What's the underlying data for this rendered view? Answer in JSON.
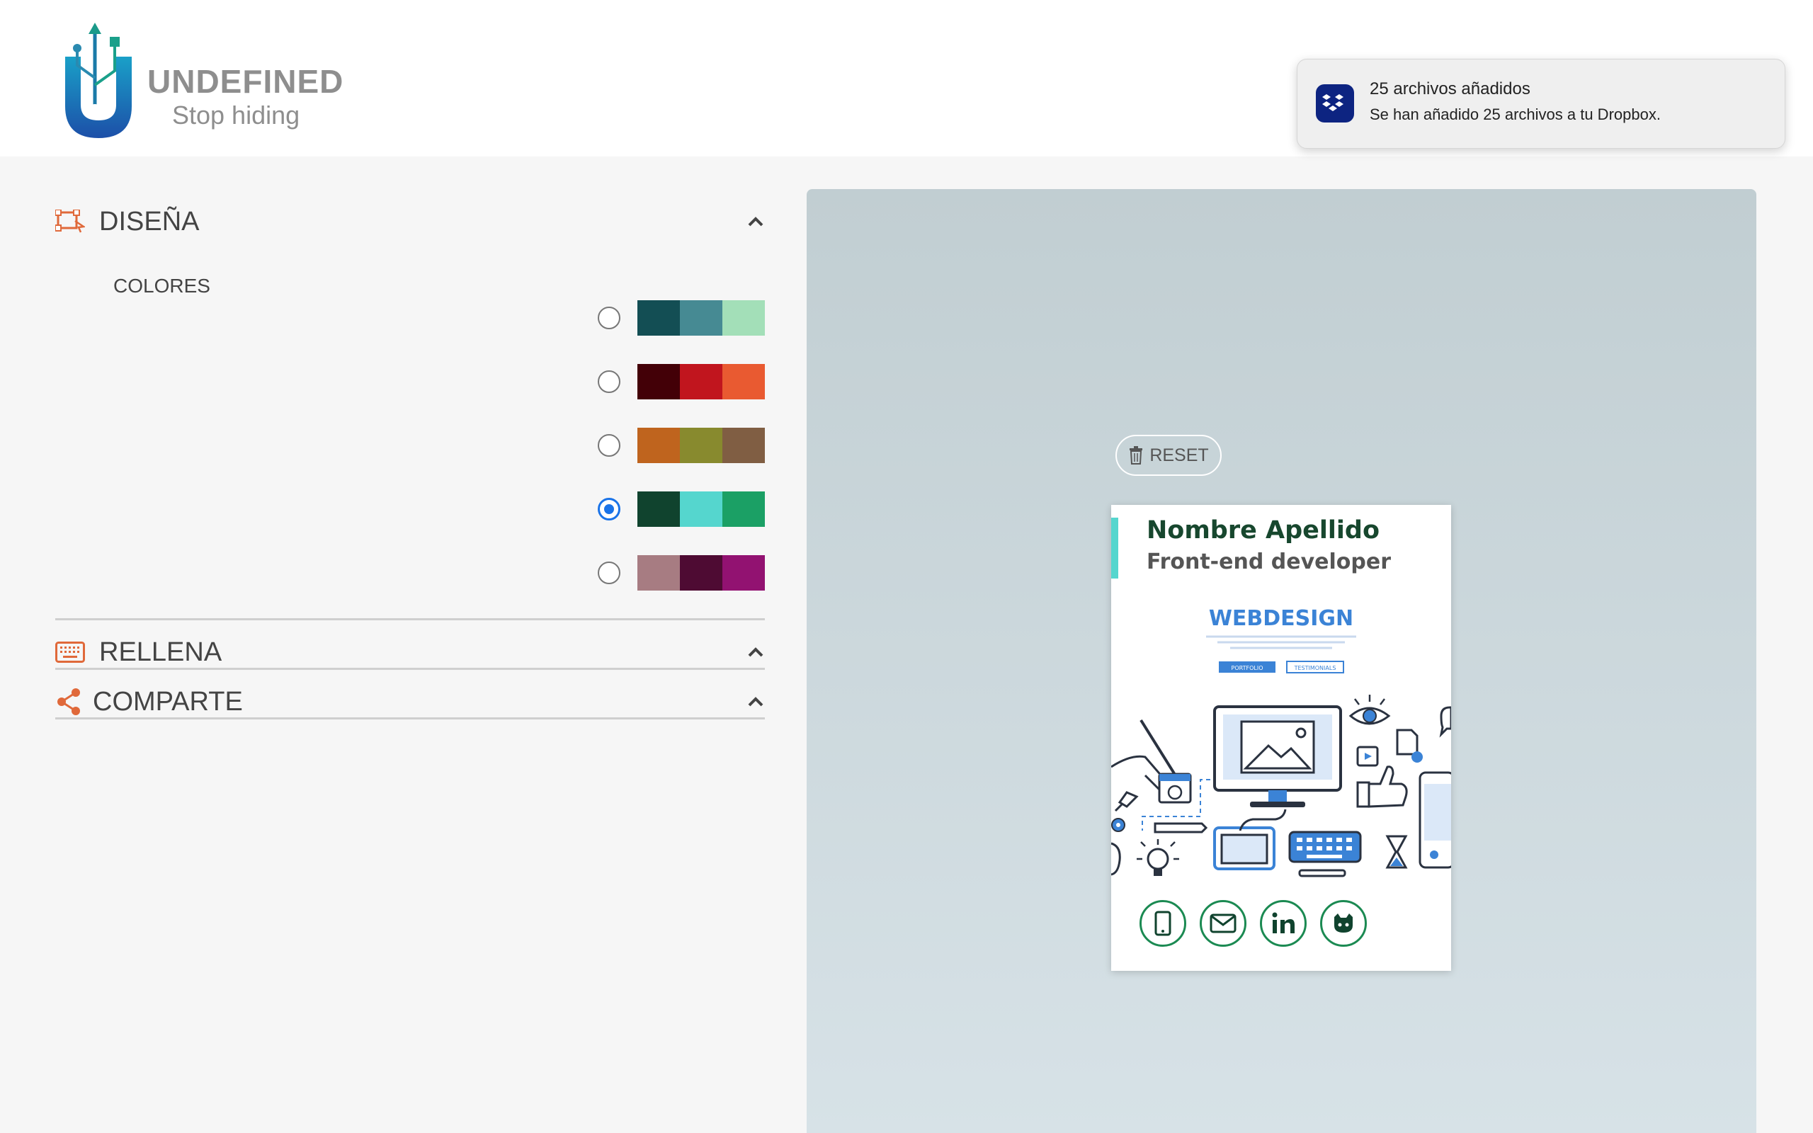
{
  "brand": {
    "name": "UNDEFINED",
    "tagline": "Stop hiding"
  },
  "notification": {
    "app_icon": "dropbox-icon",
    "title": "25 archivos añadidos",
    "body": "Se han añadido 25 archivos a tu Dropbox."
  },
  "sidebar": {
    "accent_color": "#e0693a",
    "sections": [
      {
        "label": "DISEÑA",
        "icon": "design-icon",
        "expanded": true
      },
      {
        "label": "RELLENA",
        "icon": "keyboard-icon",
        "expanded": false
      },
      {
        "label": "COMPARTE",
        "icon": "share-icon",
        "expanded": false
      }
    ],
    "colores_label": "COLORES",
    "palettes": [
      {
        "colors": [
          "#134e54",
          "#468a93",
          "#a3dfb8"
        ],
        "selected": false
      },
      {
        "colors": [
          "#430007",
          "#c1151e",
          "#e95a31"
        ],
        "selected": false
      },
      {
        "colors": [
          "#bf641e",
          "#888a2e",
          "#805e43"
        ],
        "selected": false
      },
      {
        "colors": [
          "#10432e",
          "#55d6ce",
          "#1ba065"
        ],
        "selected": true
      },
      {
        "colors": [
          "#a77c82",
          "#4e0b33",
          "#921271"
        ],
        "selected": false
      }
    ]
  },
  "preview": {
    "reset_label": "RESET",
    "card": {
      "name": "Nombre Apellido",
      "role": "Front-end developer",
      "accent_color": "#55d6ce",
      "illustration_title": "WEBDESIGN",
      "illustration_btn1": "PORTFOLIO",
      "illustration_btn2": "TESTIMONIALS",
      "contact_icons": [
        "phone-icon",
        "email-icon",
        "linkedin-icon",
        "github-icon"
      ]
    }
  }
}
